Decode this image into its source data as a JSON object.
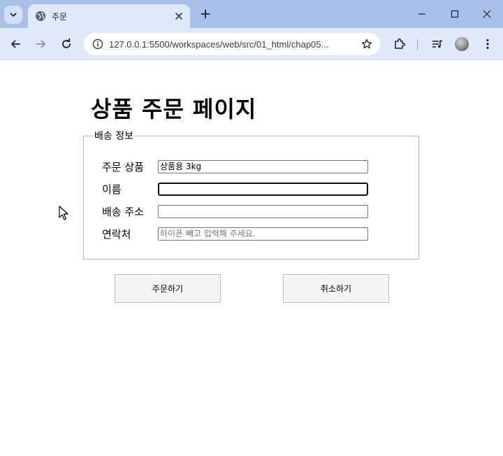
{
  "browser": {
    "tab_title": "주문",
    "url": "127.0.0.1:5500/workspaces/web/src/01_html/chap05..."
  },
  "page": {
    "title": "상품 주문 페이지",
    "fieldset_legend": "배송 정보",
    "fields": {
      "product": {
        "label": "주문 상품",
        "value": "상품용 3kg"
      },
      "name": {
        "label": "이름",
        "value": ""
      },
      "address": {
        "label": "배송 주소",
        "value": ""
      },
      "phone": {
        "label": "연락처",
        "placeholder": "하이픈 빼고 입력해 주세요."
      }
    },
    "buttons": {
      "order": "주문하기",
      "cancel": "취소하기"
    }
  },
  "icons": {
    "tab_search": "chevron-down-icon",
    "favicon": "globe-icon",
    "tab_close": "close-icon",
    "new_tab": "plus-icon",
    "minimize": "minimize-icon",
    "maximize": "maximize-icon",
    "close_window": "close-icon",
    "back": "arrow-left-icon",
    "forward": "arrow-right-icon",
    "reload": "reload-icon",
    "site_info": "info-icon",
    "bookmark": "star-icon",
    "extensions": "puzzle-icon",
    "media": "media-queue-icon",
    "profile": "avatar",
    "menu": "kebab-menu-icon",
    "cursor": "mouse-pointer-icon"
  }
}
